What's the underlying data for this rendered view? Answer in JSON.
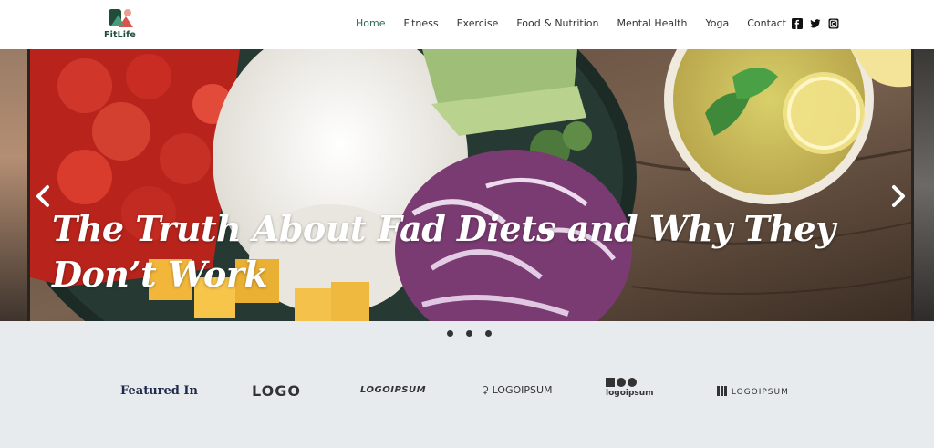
{
  "header": {
    "logo_text": "FitLife",
    "nav": [
      {
        "label": "Home",
        "active": true
      },
      {
        "label": "Fitness"
      },
      {
        "label": "Exercise"
      },
      {
        "label": "Food & Nutrition"
      },
      {
        "label": "Mental Health"
      },
      {
        "label": "Yoga"
      },
      {
        "label": "Contact",
        "dropdown": true
      }
    ],
    "social": [
      "facebook-icon",
      "twitter-icon",
      "instagram-icon"
    ]
  },
  "slider": {
    "title": "The Truth About Fad Diets and Why They Don’t Work",
    "dots": 3,
    "prev_icon": "chevron-left-icon",
    "next_icon": "chevron-right-icon"
  },
  "featured": {
    "heading": "Featured In",
    "logos": [
      "LOGO",
      "LOGOIPSUM",
      "LOGOIPSUM",
      "logoipsum",
      "LOGOIPSUM"
    ]
  },
  "colors": {
    "accent": "#2e6b50",
    "band": "#e7ebee",
    "heading": "#1e2a4a"
  }
}
